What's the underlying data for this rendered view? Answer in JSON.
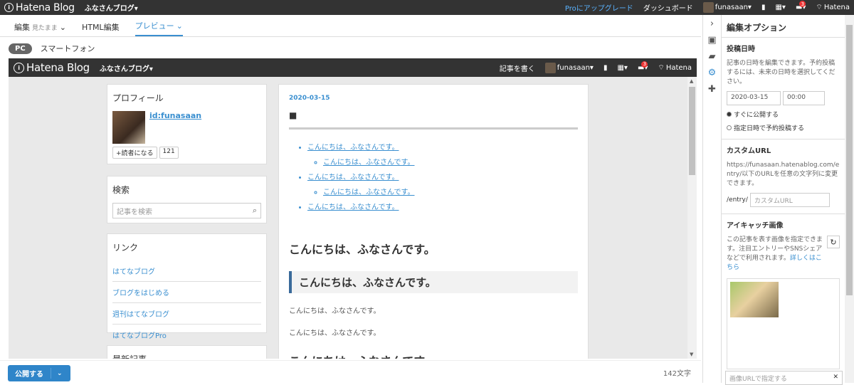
{
  "topbar": {
    "logo_text": "Hatena Blog",
    "blog_name": "ふなさんブログ▾",
    "pro_upgrade": "Proにアップグレード",
    "dashboard": "ダッシュボード",
    "user": "funasaan▾",
    "notif_count": "3",
    "hatena": "Hatena"
  },
  "tabs": {
    "edit": "編集",
    "edit_sub": "見たまま",
    "html": "HTML編集",
    "preview": "プレビュー"
  },
  "device": {
    "pc": "PC",
    "smartphone": "スマートフォン"
  },
  "preview_bar": {
    "logo_text": "Hatena Blog",
    "blog_name": "ふなさんブログ▾",
    "write": "記事を書く",
    "user": "funasaan▾",
    "notif_count": "3",
    "hatena": "Hatena"
  },
  "profile": {
    "title": "プロフィール",
    "id": "id:funasaan",
    "reader_btn": "+読者になる",
    "reader_count": "121"
  },
  "search": {
    "title": "検索",
    "placeholder": "記事を検索"
  },
  "links": {
    "title": "リンク",
    "items": [
      "はてなブログ",
      "ブログをはじめる",
      "週刊はてなブログ",
      "はてなブログPro"
    ]
  },
  "recent": {
    "title": "最新記事"
  },
  "article": {
    "date": "2020-03-15",
    "square": "■",
    "toc": [
      "こんにちは、ふなさんです。",
      "こんにちは、ふなさんです。",
      "こんにちは、ふなさんです。",
      "こんにちは、ふなさんです。",
      "こんにちは、ふなさんです。"
    ],
    "h1": "こんにちは、ふなさんです。",
    "h2": "こんにちは、ふなさんです。",
    "p1": "こんにちは、ふなさんです。",
    "p2": "こんにちは、ふなさんです。",
    "h1b": "こんにちは、ふなさんです。"
  },
  "options": {
    "title": "編集オプション",
    "post_date": {
      "heading": "投稿日時",
      "desc": "記事の日時を編集できます。予約投稿するには、未来の日時を選択してください。",
      "date": "2020-03-15",
      "time": "00:00",
      "radio_now": "すぐに公開する",
      "radio_scheduled": "指定日時で予約投稿する"
    },
    "custom_url": {
      "heading": "カスタムURL",
      "desc": "https://funasaan.hatenablog.com/entry/以下のURLを任意の文字列に変更できます。",
      "prefix": "/entry/",
      "placeholder": "カスタムURL"
    },
    "eyecatch": {
      "heading": "アイキャッチ画像",
      "desc": "この記事を表す画像を指定できます。注目エントリーやSNSシェアなどで利用されます。",
      "more": "詳しくはこちら",
      "url_placeholder": "画像URLで指定する"
    }
  },
  "bottom": {
    "publish": "公開する",
    "char_count": "142文字"
  }
}
